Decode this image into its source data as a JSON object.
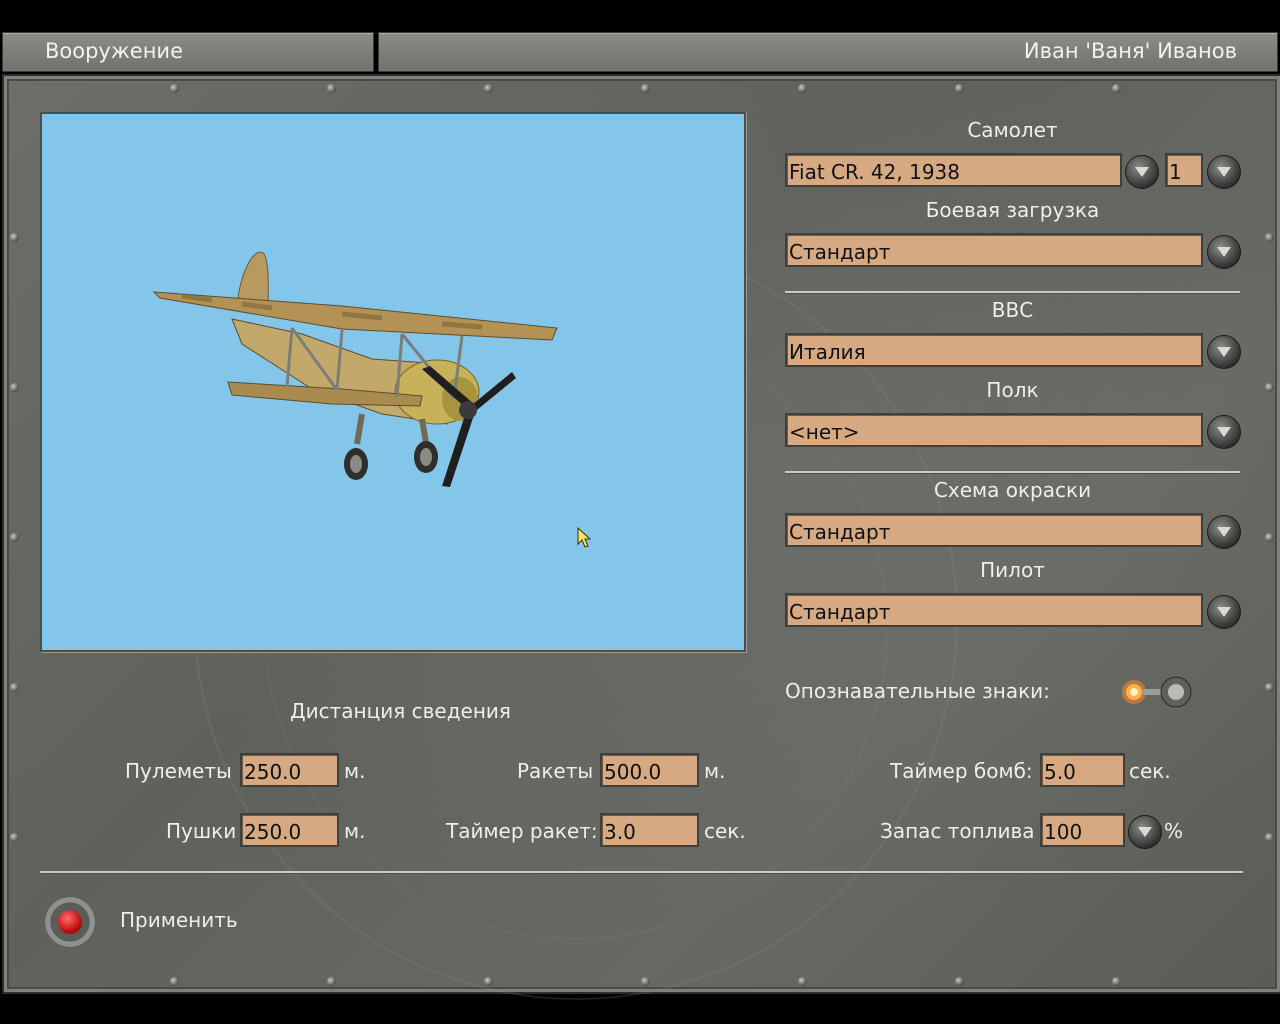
{
  "header": {
    "title": "Вооружение",
    "user": "Иван 'Ваня' Иванов"
  },
  "aircraft": {
    "label": "Самолет",
    "value": "Fiat CR. 42, 1938",
    "count": "1"
  },
  "loadout": {
    "label": "Боевая загрузка",
    "value": "Стандарт"
  },
  "airforce": {
    "label": "ВВС",
    "value": "Италия"
  },
  "regiment": {
    "label": "Полк",
    "value": "<нет>"
  },
  "skin": {
    "label": "Схема окраски",
    "value": "Стандарт"
  },
  "pilot": {
    "label": "Пилот",
    "value": "Стандарт"
  },
  "markings": {
    "label": "Опознавательные знаки:",
    "enabled": true
  },
  "convergence": {
    "title": "Дистанция сведения",
    "mg_label": "Пулеметы",
    "mg_value": "250.0",
    "mg_unit": "м.",
    "cannon_label": "Пушки",
    "cannon_value": "250.0",
    "cannon_unit": "м.",
    "rockets_label": "Ракеты",
    "rockets_value": "500.0",
    "rockets_unit": "м.",
    "rocket_timer_label": "Таймер ракет:",
    "rocket_timer_value": "3.0",
    "rocket_timer_unit": "сек.",
    "bomb_timer_label": "Таймер бомб:",
    "bomb_timer_value": "5.0",
    "bomb_timer_unit": "сек.",
    "fuel_label": "Запас топлива",
    "fuel_value": "100",
    "fuel_unit": "%"
  },
  "footer": {
    "apply_label": "Применить"
  },
  "colors": {
    "field": "#d6a982",
    "viewport_sky": "#84c6ea",
    "panel": "#676965"
  }
}
